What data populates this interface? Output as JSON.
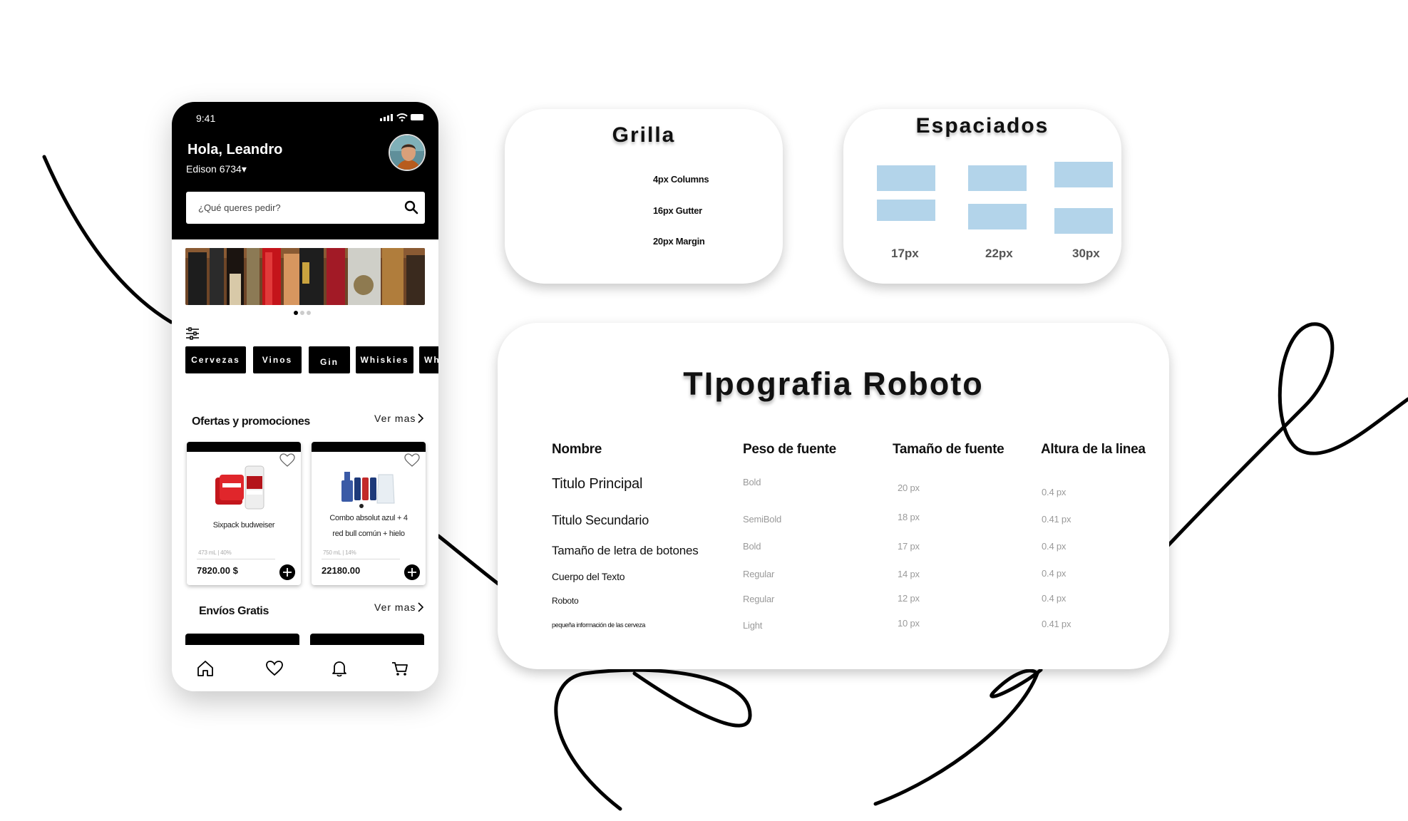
{
  "phone": {
    "status_time": "9:41",
    "greeting": "Hola, Leandro",
    "location": "Edison 6734▾",
    "search_placeholder": "¿Qué queres pedir?",
    "categories": [
      "Cervezas",
      "Vinos",
      "Gin",
      "Whiskies",
      "Wh"
    ],
    "offers_title": "Ofertas y promociones",
    "ver_mas": "Ver mas",
    "products": [
      {
        "name_line1": "Sixpack budweiser",
        "name_line2": "",
        "meta": "473 mL  |  40%",
        "price": "7820.00 $"
      },
      {
        "name_line1": "Combo absolut azul + 4",
        "name_line2": "red bull común + hielo",
        "meta": "750 mL  |  14%",
        "price": "22180.00"
      }
    ],
    "free_shipping_title": "Envíos Gratis",
    "tabs": [
      "home-icon",
      "heart-icon",
      "bell-icon",
      "cart-icon"
    ],
    "carousel": {
      "pages": 3,
      "active": 1
    }
  },
  "grid_panel": {
    "title": "Grilla",
    "items": [
      "4px Columns",
      "16px Gutter",
      "20px Margin"
    ]
  },
  "spacing_panel": {
    "title": "Espaciados",
    "labels": [
      "17px",
      "22px",
      "30px"
    ],
    "swatch_color": "#b3d4ea"
  },
  "typography_panel": {
    "title": "TIpografia  Roboto",
    "headers": [
      "Nombre",
      "Peso de fuente",
      "Tamaño  de fuente",
      "Altura de la linea"
    ],
    "rows": [
      [
        "Titulo Principal",
        "Bold",
        "20 px",
        "0.4 px"
      ],
      [
        "Titulo Secundario",
        "SemiBold",
        "18 px",
        "0.41 px"
      ],
      [
        "Tamaño de letra de botones",
        "Bold",
        "17 px",
        "0.4 px"
      ],
      [
        "Cuerpo del Texto",
        "Regular",
        "14 px",
        "0.4 px"
      ],
      [
        "Roboto",
        "Regular",
        "12 px",
        "0.4 px"
      ],
      [
        "pequeña información de las cerveza",
        "Light",
        "10 px",
        "0.41 px"
      ]
    ]
  }
}
